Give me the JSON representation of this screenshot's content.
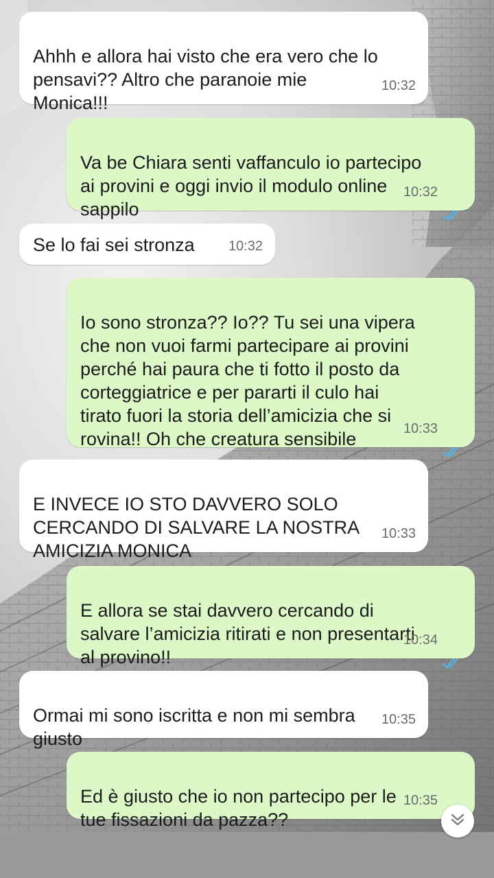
{
  "conversation": {
    "messages": [
      {
        "direction": "incoming",
        "text": "Ahhh e allora hai visto che era vero che lo\npensavi?? Altro che paranoie mie\nMonica!!!",
        "time": "10:32"
      },
      {
        "direction": "outgoing",
        "text": "Va be Chiara senti vaffanculo io partecipo\nai provini e oggi invio il modulo online\nsappilo",
        "time": "10:32",
        "status": "read"
      },
      {
        "direction": "incoming",
        "text": "Se lo fai sei stronza",
        "time": "10:32"
      },
      {
        "direction": "outgoing",
        "text": "Io sono stronza?? Io?? Tu sei una vipera\nche non vuoi farmi partecipare ai provini\nperché hai paura che ti fotto il posto da\ncorteggiatrice e per pararti il culo hai\ntirato fuori la storia dell’amicizia che si\nrovina!! Oh che creatura sensibile",
        "time": "10:33",
        "status": "read"
      },
      {
        "direction": "incoming",
        "text": "E INVECE IO STO DAVVERO SOLO\nCERCANDO DI SALVARE LA NOSTRA\nAMICIZIA MONICA",
        "time": "10:33"
      },
      {
        "direction": "outgoing",
        "text": "E allora se stai davvero cercando di\nsalvare l’amicizia ritirati e non presentarti\nal provino!!",
        "time": "10:34",
        "status": "read"
      },
      {
        "direction": "incoming",
        "text": "Ormai mi sono iscritta e non mi sembra\ngiusto",
        "time": "10:35"
      },
      {
        "direction": "outgoing",
        "text": "Ed è giusto che io non partecipo per le\ntue fissazioni da pazza??",
        "time": "10:35",
        "status": "pending"
      }
    ]
  },
  "colors": {
    "incoming_bubble": "#ffffff",
    "outgoing_bubble": "#dcf8c6",
    "read_ticks": "#4fb6ec",
    "time_text": "#6a6a6a"
  },
  "icons": {
    "read_receipt": "double-check-icon",
    "scroll_down": "chevron-double-down-icon"
  }
}
